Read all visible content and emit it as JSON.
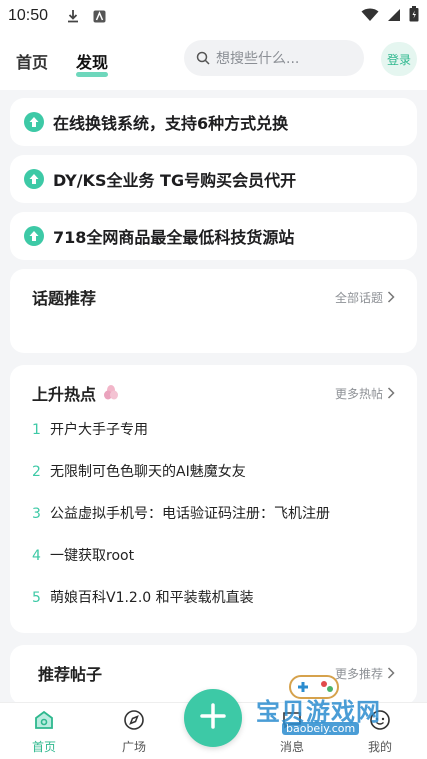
{
  "status_bar": {
    "time": "10:50"
  },
  "header": {
    "tabs": [
      {
        "label": "首页"
      },
      {
        "label": "发现"
      }
    ],
    "search_placeholder": "想搜些什么...",
    "login_label": "登录"
  },
  "notices": [
    {
      "text": "在线换钱系统，支持6种方式兑换"
    },
    {
      "text": "DY/KS全业务 TG号购买会员代开"
    },
    {
      "text": "718全网商品最全最低科技货源站"
    }
  ],
  "topics": {
    "title": "话题推荐",
    "more_label": "全部话题"
  },
  "hot": {
    "title": "上升热点",
    "more_label": "更多热帖",
    "items": [
      {
        "num": "1",
        "text": "开户大手子专用"
      },
      {
        "num": "2",
        "text": "无限制可色色聊天的AI魅魔女友"
      },
      {
        "num": "3",
        "text": "公益虚拟手机号：电话验证码注册：飞机注册"
      },
      {
        "num": "4",
        "text": "一键获取root"
      },
      {
        "num": "5",
        "text": "萌娘百科V1.2.0 和平装载机直装"
      }
    ]
  },
  "recommend": {
    "title": "推荐帖子",
    "more_label": "更多推荐"
  },
  "bottom_nav": {
    "home": "首页",
    "square": "广场",
    "messages": "消息",
    "mine": "我的"
  },
  "watermark": {
    "title": "宝贝游戏网",
    "url": "baobeiy.com"
  },
  "colors": {
    "accent": "#3dc9a6",
    "background": "#f4f5f7"
  }
}
